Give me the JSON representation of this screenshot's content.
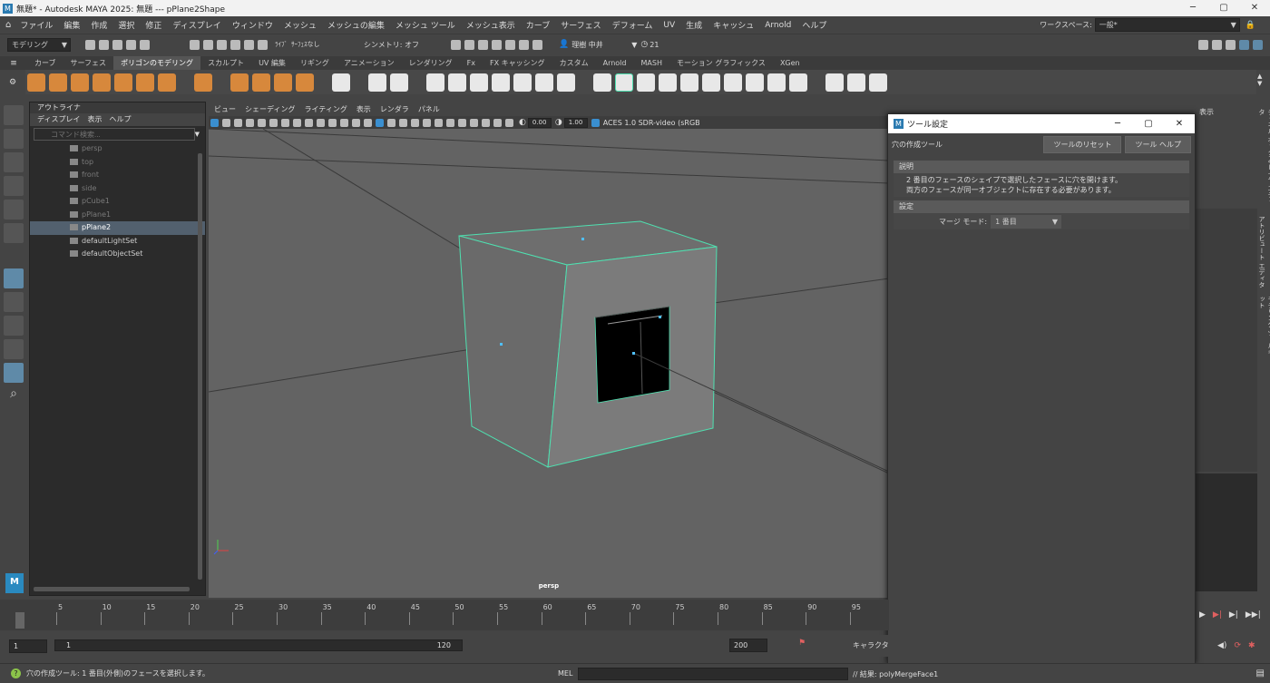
{
  "titlebar": {
    "title": "無題* - Autodesk MAYA 2025: 無題   ---   pPlane2Shape",
    "minimize": "─",
    "maximize": "▢",
    "close": "✕"
  },
  "menubar": {
    "items": [
      "ファイル",
      "編集",
      "作成",
      "選択",
      "修正",
      "ディスプレイ",
      "ウィンドウ",
      "メッシュ",
      "メッシュの編集",
      "メッシュ ツール",
      "メッシュ表示",
      "カーブ",
      "サーフェス",
      "デフォーム",
      "UV",
      "生成",
      "キャッシュ",
      "Arnold",
      "ヘルプ"
    ],
    "workspace_label": "ワークスペース:",
    "workspace_value": "一般*"
  },
  "statusline": {
    "mode": "モデリング",
    "live_surface": "ｻｰﾌｪｽなし",
    "live_label": "ﾗｲﾌﾞ",
    "symmetry": "シンメトリ: オフ",
    "user": "理樹 中井",
    "notifications": "21"
  },
  "shelf": {
    "tabs": [
      "カーブ",
      "サーフェス",
      "ポリゴンのモデリング",
      "スカルプト",
      "UV 編集",
      "リギング",
      "アニメーション",
      "レンダリング",
      "Fx",
      "FX キャッシング",
      "カスタム",
      "Arnold",
      "MASH",
      "モーション グラフィックス",
      "XGen"
    ],
    "active_tab": "ポリゴンのモデリング"
  },
  "outliner": {
    "tab": "アウトライナ",
    "menu": [
      "ディスプレイ",
      "表示",
      "ヘルプ"
    ],
    "search_placeholder": "コマンド検索...",
    "items": [
      {
        "label": "persp",
        "dim": true,
        "icon": "camera-icon"
      },
      {
        "label": "top",
        "dim": true,
        "icon": "camera-icon"
      },
      {
        "label": "front",
        "dim": true,
        "icon": "camera-icon"
      },
      {
        "label": "side",
        "dim": true,
        "icon": "camera-icon"
      },
      {
        "label": "pCube1",
        "dim": true,
        "icon": "mesh-icon"
      },
      {
        "label": "pPlane1",
        "dim": true,
        "icon": "mesh-icon"
      },
      {
        "label": "pPlane2",
        "dim": false,
        "selected": true,
        "icon": "mesh-icon"
      },
      {
        "label": "defaultLightSet",
        "dim": false,
        "icon": "set-icon"
      },
      {
        "label": "defaultObjectSet",
        "dim": false,
        "icon": "set-icon"
      }
    ]
  },
  "viewport": {
    "menu": [
      "ビュー",
      "シェーディング",
      "ライティング",
      "表示",
      "レンダラ",
      "パネル"
    ],
    "exposure": "0.00",
    "gamma": "1.00",
    "colorspace": "ACES 1.0 SDR-video (sRGB",
    "camera_label": "persp"
  },
  "tool_settings": {
    "title": "ツール設定",
    "tool_name": "穴の作成ツール",
    "reset_button": "ツールのリセット",
    "help_button": "ツール ヘルプ",
    "description_header": "説明",
    "description_lines": [
      "2 番目のフェースのシェイプで選択したフェースに穴を開けます。",
      "両方のフェースが同一オブジェクトに存在する必要があります。"
    ],
    "settings_header": "設定",
    "merge_mode_label": "マージ モード:",
    "merge_mode_value": "1 番目"
  },
  "right_panel": {
    "show_label": "表示",
    "vertical_tabs": [
      "チャネル ボックス/レイヤ エディタ",
      "アトリビュート エディタ",
      "モデリング ツールキット"
    ]
  },
  "timeslider": {
    "ticks": [
      "1",
      "5",
      "10",
      "15",
      "20",
      "25",
      "30",
      "35",
      "40",
      "45",
      "50",
      "55",
      "60",
      "65",
      "70",
      "75",
      "80",
      "85",
      "90",
      "95"
    ]
  },
  "range": {
    "start": "1",
    "inner_start": "1",
    "inner_end": "120",
    "end": "200",
    "char_label": "キャラクタ"
  },
  "helpline": {
    "message": "穴の作成ツール: 1 番目(外側)のフェースを選択します。",
    "mel_label": "MEL",
    "result": "// 結果: polyMergeFace1"
  },
  "colors": {
    "accent": "#5f8aa8",
    "selection": "#4fe0b0",
    "shelf_orange": "#d7883c"
  }
}
